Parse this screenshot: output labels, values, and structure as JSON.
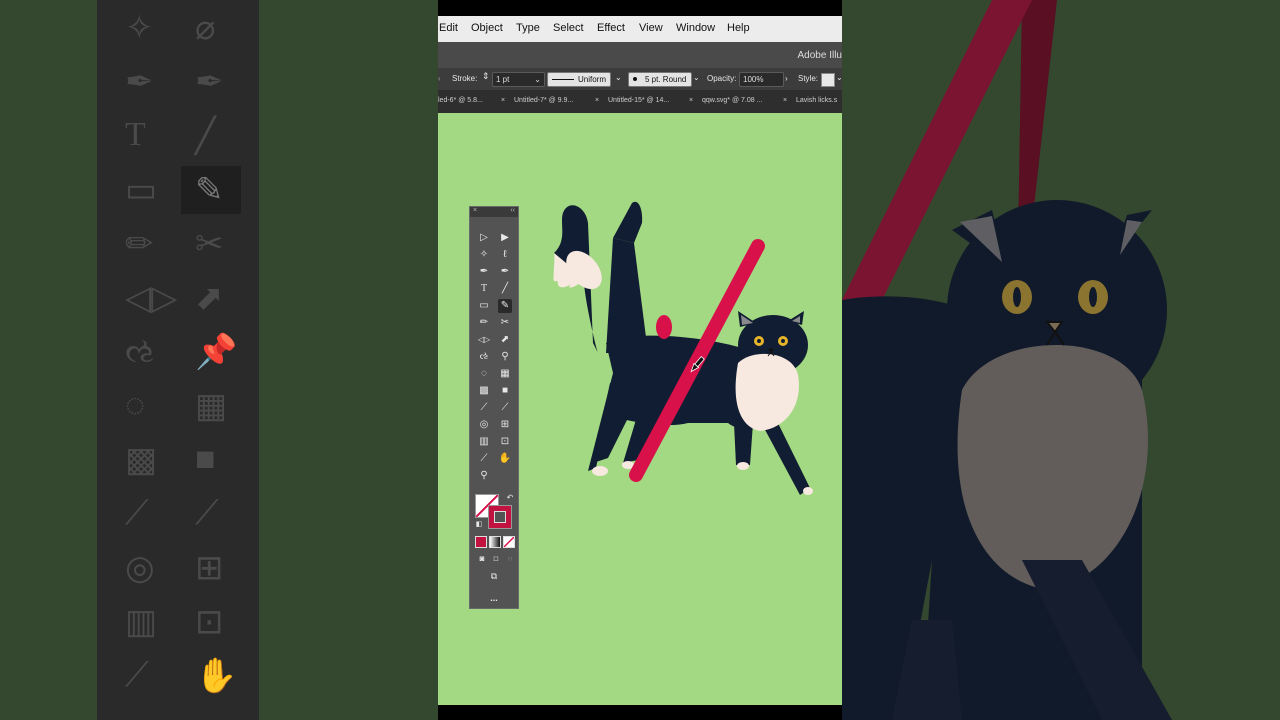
{
  "app": {
    "name": "Adobe Illu"
  },
  "menu": [
    "Edit",
    "Object",
    "Type",
    "Select",
    "Effect",
    "View",
    "Window",
    "Help"
  ],
  "control_bar": {
    "stroke_label": "Stroke:",
    "stroke_value": "1 pt",
    "profile_value": "Uniform",
    "brush_value": "5 pt. Round",
    "opacity_label": "Opacity:",
    "opacity_value": "100%",
    "style_label": "Style:"
  },
  "tabs": [
    {
      "label": "led-6* @ 5.8..."
    },
    {
      "label": "Untitled-7* @ 9.9..."
    },
    {
      "label": "Untitled-15* @ 14..."
    },
    {
      "label": "qqw.svg* @ 7.08 ..."
    },
    {
      "label": "Lavish licks.s"
    }
  ],
  "toolbox": {
    "more_label": "..."
  },
  "colors": {
    "canvas": "#a3d982",
    "stroke": "#c2123f",
    "cat_body": "#111d33",
    "cat_chest": "#f7e8e0",
    "brush_stroke": "#d8114a",
    "eye": "#e8b52a"
  },
  "icons": {
    "tools": [
      "selection-icon",
      "direct-selection-icon",
      "magic-wand-icon",
      "lasso-icon",
      "pen-icon",
      "curvature-icon",
      "type-icon",
      "line-icon",
      "rectangle-icon",
      "paintbrush-icon",
      "pencil-icon",
      "scissors-icon",
      "reflect-icon",
      "free-transform-icon",
      "warp-icon",
      "puppet-warp-icon",
      "shape-builder-icon",
      "perspective-icon",
      "mesh-icon",
      "gradient-icon",
      "eyedropper-icon",
      "eyedropper2-icon",
      "blend-icon",
      "symbol-sprayer-icon",
      "column-graph-icon",
      "artboard-icon",
      "slice-icon",
      "hand-icon",
      "zoom-icon"
    ]
  }
}
